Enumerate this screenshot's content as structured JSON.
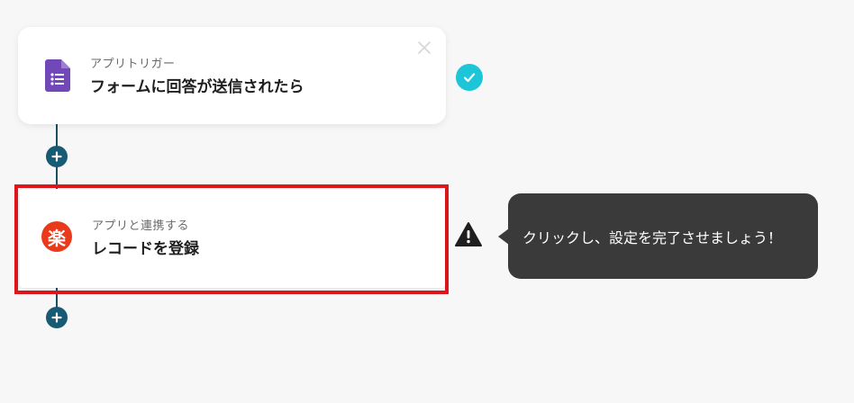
{
  "flow": {
    "steps": [
      {
        "kind": "trigger",
        "subtitle": "アプリトリガー",
        "title": "フォームに回答が送信されたら",
        "app_icon": "google-forms-icon",
        "status": "completed"
      },
      {
        "kind": "action",
        "subtitle": "アプリと連携する",
        "title": "レコードを登録",
        "app_icon": "rakuraku-icon",
        "app_icon_glyph": "楽",
        "status": "warning",
        "highlighted": true
      }
    ]
  },
  "tooltip": {
    "text": "クリックし、設定を完了させましょう！"
  },
  "colors": {
    "background": "#f7f7f7",
    "connector": "#1d4e63",
    "plus_button": "#175a73",
    "check_badge": "#1dc5d8",
    "highlight_border": "#e0161b",
    "tooltip_bg": "#3a3a3a",
    "raku_icon": "#ea3a1c",
    "forms_icon": "#7248b9"
  }
}
